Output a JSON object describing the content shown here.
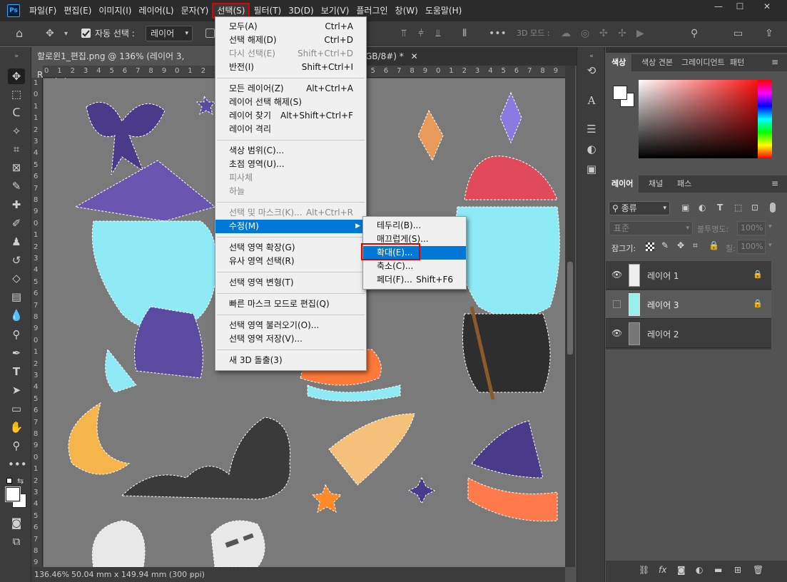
{
  "app": {
    "logo": "Ps",
    "menus": [
      "파일(F)",
      "편집(E)",
      "이미지(I)",
      "레이어(L)",
      "문자(Y)",
      "선택(S)",
      "필터(T)",
      "3D(D)",
      "보기(V)",
      "플러그인",
      "창(W)",
      "도움말(H)"
    ],
    "active_menu": "선택(S)"
  },
  "options_bar": {
    "auto_select_label": "자동 선택 :",
    "auto_select_value": "레이어",
    "mode_3d_label": "3D 모드 :"
  },
  "document": {
    "tab_title": "할로윈1_편집.png @ 136% (레이어 3, RGB/8) *",
    "tab2_suffix": "GB/8#) *",
    "zoom": "136.46%",
    "dimensions": "50.04 mm x 149.94 mm (300 ppi)"
  },
  "rulers": {
    "top": [
      "0",
      "1",
      "2",
      "3",
      "4",
      "5",
      "6",
      "7",
      "8",
      "9",
      "0",
      "1",
      "2",
      "3",
      "4",
      "5",
      "6",
      "7",
      "8",
      "9",
      "0",
      "1",
      "2",
      "3",
      "4",
      "5",
      "6",
      "7",
      "8",
      "9",
      "0",
      "1",
      "2",
      "3",
      "4",
      "5",
      "6",
      "7",
      "8",
      "9"
    ],
    "left": [
      "1",
      "0",
      "1",
      "1",
      "2",
      "3",
      "4",
      "5",
      "6",
      "7",
      "8",
      "9",
      "0",
      "1",
      "2",
      "3",
      "4",
      "5",
      "6",
      "7",
      "8",
      "9",
      "0",
      "1",
      "2",
      "3",
      "4",
      "5",
      "6",
      "7",
      "8",
      "9",
      "0",
      "1",
      "2",
      "3",
      "4",
      "5",
      "6",
      "7",
      "8",
      "9"
    ]
  },
  "select_menu": [
    {
      "label": "모두(A)",
      "shortcut": "Ctrl+A"
    },
    {
      "label": "선택 해제(D)",
      "shortcut": "Ctrl+D"
    },
    {
      "label": "다시 선택(E)",
      "shortcut": "Shift+Ctrl+D",
      "disabled": true
    },
    {
      "label": "반전(I)",
      "shortcut": "Shift+Ctrl+I"
    },
    {
      "sep": true
    },
    {
      "label": "모든 레이어(Z)",
      "shortcut": "Alt+Ctrl+A"
    },
    {
      "label": "레이어 선택 해제(S)",
      "shortcut": ""
    },
    {
      "label": "레이어 찾기",
      "shortcut": "Alt+Shift+Ctrl+F"
    },
    {
      "label": "레이어 격리",
      "shortcut": ""
    },
    {
      "sep": true
    },
    {
      "label": "색상 범위(C)...",
      "shortcut": ""
    },
    {
      "label": "초점 영역(U)...",
      "shortcut": ""
    },
    {
      "label": "피사체",
      "shortcut": "",
      "disabled": true
    },
    {
      "label": "하늘",
      "shortcut": "",
      "disabled": true
    },
    {
      "sep": true
    },
    {
      "label": "선택 및 마스크(K)...",
      "shortcut": "Alt+Ctrl+R",
      "disabled": true
    },
    {
      "label": "수정(M)",
      "shortcut": "",
      "highlight": true,
      "submenu": true
    },
    {
      "sep": true
    },
    {
      "label": "선택 영역 확장(G)",
      "shortcut": ""
    },
    {
      "label": "유사 영역 선택(R)",
      "shortcut": ""
    },
    {
      "sep": true
    },
    {
      "label": "선택 영역 변형(T)",
      "shortcut": ""
    },
    {
      "sep": true
    },
    {
      "label": "빠른 마스크 모드로 편집(Q)",
      "shortcut": ""
    },
    {
      "sep": true
    },
    {
      "label": "선택 영역 불러오기(O)...",
      "shortcut": ""
    },
    {
      "label": "선택 영역 저장(V)...",
      "shortcut": ""
    },
    {
      "sep": true
    },
    {
      "label": "새 3D 돌출(3)",
      "shortcut": ""
    }
  ],
  "modify_submenu": [
    {
      "label": "테두리(B)...",
      "shortcut": ""
    },
    {
      "label": "매끄럽게(S)...",
      "shortcut": ""
    },
    {
      "label": "확대(E)...",
      "shortcut": "",
      "highlight": true
    },
    {
      "label": "축소(C)...",
      "shortcut": ""
    },
    {
      "label": "페더(F)...",
      "shortcut": "Shift+F6"
    }
  ],
  "color_panel": {
    "tabs": [
      "색상",
      "색상 견본",
      "그레이디언트",
      "패턴"
    ],
    "hue_color": "#ff0000"
  },
  "layers_panel": {
    "tabs": [
      "레이어",
      "채널",
      "패스"
    ],
    "filter_label": "종류",
    "blend_mode": "표준",
    "opacity_label": "불투명도:",
    "opacity_value": "100%",
    "lock_label": "잠그기:",
    "fill_label": "칠:",
    "fill_value": "100%",
    "layers": [
      {
        "name": "레이어 1",
        "visible": true,
        "selected": false
      },
      {
        "name": "레이어 3",
        "visible": false,
        "selected": true
      },
      {
        "name": "레이어 2",
        "visible": true,
        "selected": false
      }
    ]
  },
  "colors": {
    "highlight": "#0078d7",
    "callout": "#e00000"
  }
}
